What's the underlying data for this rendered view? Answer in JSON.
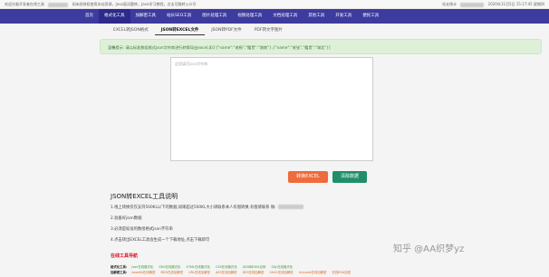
{
  "topbar": {
    "left_text": "欢迎光临开发者在线工具",
    "left_note": "如未经授权使用本站资源，Java面试题库，Java学习教程，点击可跳转公众号",
    "right_link": "站长统计",
    "datetime": "2020年11月5日 15:17:45 星期四"
  },
  "nav": {
    "items": [
      "首页",
      "格式化工具",
      "加解密工具",
      "站长SEO工具",
      "图片处理工具",
      "视频处理工具",
      "文档处理工具",
      "其他工具",
      "开发工具",
      "便民工具"
    ]
  },
  "tabs": [
    "EXCEL转JSON格式",
    "JSON转EXCEL文件",
    "JSON转PDF文件",
    "PDF转文字图片"
  ],
  "notice": "温馨提示: 请以标准数组格式json字符串进行转换导出excel,如:[{\"name\":\"老杨\",\"籍贯\":\"湖南\"},{\"name\":\"老张\",\"籍贯\":\"湖北\"}]",
  "editor": {
    "placeholder": "这里填写json字符串",
    "value": ""
  },
  "buttons": {
    "to_excel": "转换EXCEL",
    "clear": "清除数据"
  },
  "guide": {
    "title": "JSON转EXCEL工具说明",
    "lines": [
      "1.线上转换仅仅支持500KL以下的数据,如果超过500KL大小请联系本人有偿转换,有偿请联系 微:",
      "2.准备好json数据",
      "3.必须是标准的数组格式json字符串",
      "4.点击转出EXCEL工具会生成一个下载地址,点击下载即可"
    ]
  },
  "online_title": "在线工具导航",
  "tools": [
    {
      "category": "格式化工具:",
      "style": "g",
      "links": [
        "json在线格式化",
        "XML在线格式化",
        "HTML在线格式化",
        "CSS在线格式化",
        "JSON转XML互转",
        "SQL在线格式化"
      ]
    },
    {
      "category": "加解密工具:",
      "style": "o",
      "links": [
        "base64在线解密",
        "MD5在线加解密",
        "URL在线加解密",
        "AES在线加解密",
        "DES在线加解密",
        "SHA1在线加解密",
        "Unicode在线加解密",
        "在线RSA加密"
      ]
    }
  ],
  "watermark": "知乎 @AA织梦yz",
  "colors": {
    "nav_bg": "#3d3b9e",
    "notice_bg": "#dff0d8",
    "excel_btn": "#ef6b3b",
    "clear_btn": "#1f8f68",
    "online_title": "#dd1122"
  }
}
